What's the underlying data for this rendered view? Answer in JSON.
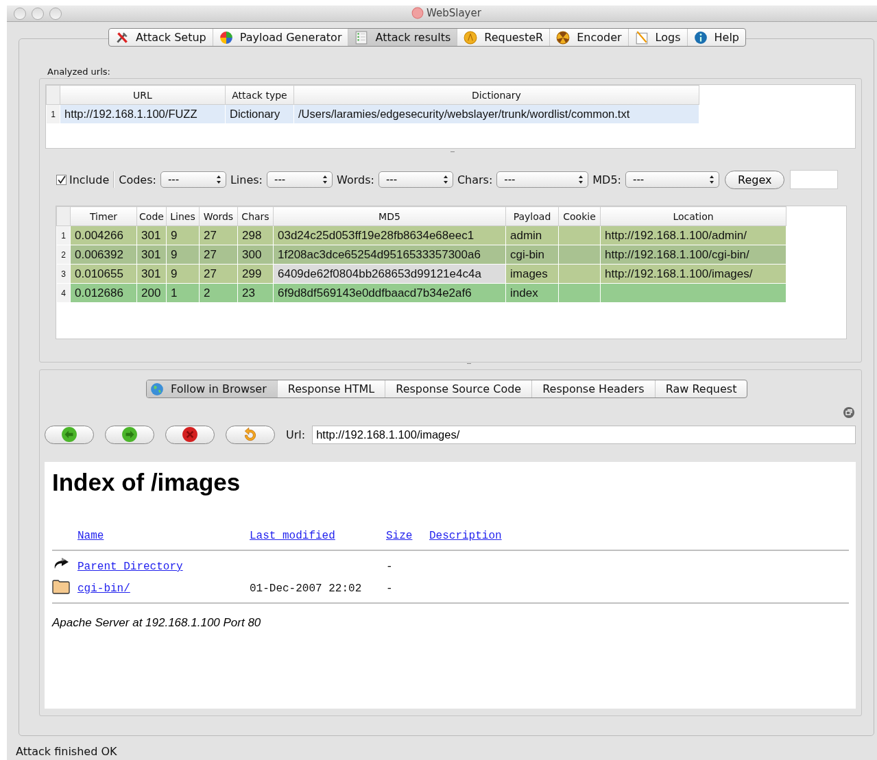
{
  "window": {
    "title": "WebSlayer"
  },
  "tabs": [
    {
      "label": "Attack Setup",
      "selected": false
    },
    {
      "label": "Payload Generator",
      "selected": false
    },
    {
      "label": "Attack results",
      "selected": true
    },
    {
      "label": "RequesteR",
      "selected": false
    },
    {
      "label": "Encoder",
      "selected": false
    },
    {
      "label": "Logs",
      "selected": false
    },
    {
      "label": "Help",
      "selected": false
    }
  ],
  "analyzed": {
    "label": "Analyzed urls:",
    "columns": [
      "URL",
      "Attack type",
      "Dictionary"
    ],
    "rows": [
      {
        "number": "1",
        "cells": [
          "http://192.168.1.100/FUZZ",
          "Dictionary",
          "/Users/laramies/edgesecurity/webslayer/trunk/wordlist/common.txt"
        ]
      }
    ]
  },
  "filters": {
    "include": {
      "label": "Include",
      "checked": true
    },
    "selects": [
      {
        "label": "Codes:",
        "value": "---"
      },
      {
        "label": "Lines:",
        "value": "---"
      },
      {
        "label": "Words:",
        "value": "---"
      },
      {
        "label": "Chars:",
        "value": "---"
      },
      {
        "label": "MD5:",
        "value": "---"
      }
    ],
    "regex_button": "Regex"
  },
  "results": {
    "columns": [
      "Timer",
      "Code",
      "Lines",
      "Words",
      "Chars",
      "MD5",
      "Payload",
      "Cookie",
      "Location"
    ],
    "rows": [
      {
        "number": "1",
        "color": "#b8cc94",
        "md5_focused": false,
        "cells": [
          "0.004266",
          "301",
          "9",
          "27",
          "298",
          "03d24c25d053ff19e28fb8634e68eec1",
          "admin",
          "",
          "http://192.168.1.100/admin/"
        ]
      },
      {
        "number": "2",
        "color": "#a9c291",
        "md5_focused": false,
        "cells": [
          "0.006392",
          "301",
          "9",
          "27",
          "300",
          "1f208ac3dce65254d9516533357300a6",
          "cgi-bin",
          "",
          "http://192.168.1.100/cgi-bin/"
        ]
      },
      {
        "number": "3",
        "color": "#b8cc94",
        "md5_focused": true,
        "cells": [
          "0.010655",
          "301",
          "9",
          "27",
          "299",
          "6409de62f0804bb268653d99121e4c4a",
          "images",
          "",
          "http://192.168.1.100/images/"
        ]
      },
      {
        "number": "4",
        "color": "#95cc8f",
        "md5_focused": false,
        "cells": [
          "0.012686",
          "200",
          "1",
          "2",
          "23",
          "6f9d8df569143e0ddfbaacd7b34e2af6",
          "index",
          "",
          ""
        ]
      }
    ]
  },
  "response_tabs": [
    {
      "label": "Follow in Browser",
      "selected": true
    },
    {
      "label": "Response HTML",
      "selected": false
    },
    {
      "label": "Response Source Code",
      "selected": false
    },
    {
      "label": "Response Headers",
      "selected": false
    },
    {
      "label": "Raw Request",
      "selected": false
    }
  ],
  "browser": {
    "nav_buttons": [
      {
        "kind": "back"
      },
      {
        "kind": "forward"
      },
      {
        "kind": "stop"
      },
      {
        "kind": "reload"
      }
    ],
    "url_label": "Url:",
    "url": "http://192.168.1.100/images/",
    "page": {
      "heading": "Index of /images",
      "columns": [
        "Name",
        "Last modified",
        "Size",
        "Description"
      ],
      "entries": [
        {
          "kind": "parent",
          "name": "Parent Directory",
          "size": "-"
        },
        {
          "kind": "folder",
          "name": "cgi-bin/",
          "modified": "01-Dec-2007 22:02",
          "size": "-"
        }
      ],
      "footer": "Apache Server at 192.168.1.100 Port 80"
    }
  },
  "status_bar": "Attack finished OK"
}
